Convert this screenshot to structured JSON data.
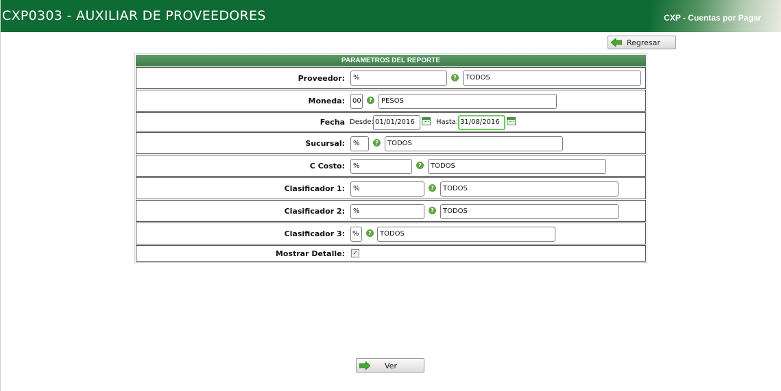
{
  "header": {
    "title": "CXP0303 - AUXILIAR DE PROVEEDORES",
    "module": "CXP - Cuentas por Pagar"
  },
  "buttons": {
    "regresar": "Regresar",
    "ver": "Ver"
  },
  "panel": {
    "title": "PARAMETROS DEL REPORTE",
    "proveedor": {
      "label": "Proveedor:",
      "code": "%",
      "desc": "TODOS"
    },
    "moneda": {
      "label": "Moneda:",
      "code": "00",
      "desc": "PESOS"
    },
    "fecha": {
      "label": "Fecha",
      "desde_label": "Desde:",
      "desde": "01/01/2016",
      "hasta_label": "Hasta:",
      "hasta": "31/08/2016"
    },
    "sucursal": {
      "label": "Sucursal:",
      "code": "%",
      "desc": "TODOS"
    },
    "ccosto": {
      "label": "C Costo:",
      "code": "%",
      "desc": "TODOS"
    },
    "clasificador1": {
      "label": "Clasificador 1:",
      "code": "%",
      "desc": "TODOS"
    },
    "clasificador2": {
      "label": "Clasificador 2:",
      "code": "%",
      "desc": "TODOS"
    },
    "clasificador3": {
      "label": "Clasificador 3:",
      "code": "%",
      "desc": "TODOS"
    },
    "detalle": {
      "label": "Mostrar Detalle:",
      "checked": true
    }
  },
  "icons": {
    "help": "help-icon",
    "calendar": "calendar-icon",
    "arrow": "green-arrow-icon"
  },
  "colors": {
    "header": "#0e6b34",
    "panel_head": "#4a8a55",
    "focus": "#6ccc53"
  }
}
